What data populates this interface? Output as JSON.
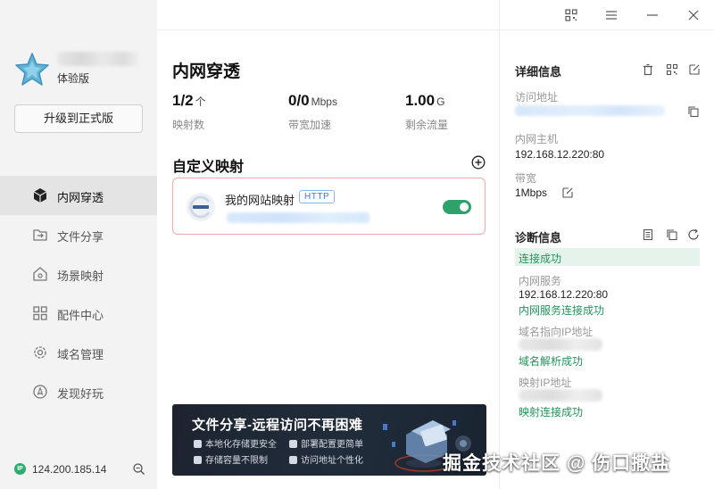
{
  "sidebar": {
    "edition": "体验版",
    "upgrade_label": "升级到正式版",
    "items": [
      {
        "label": "内网穿透",
        "icon": "cube-icon",
        "active": true
      },
      {
        "label": "文件分享",
        "icon": "folder-share-icon",
        "active": false
      },
      {
        "label": "场景映射",
        "icon": "house-icon",
        "active": false
      },
      {
        "label": "配件中心",
        "icon": "grid-icon",
        "active": false
      },
      {
        "label": "域名管理",
        "icon": "gear-icon",
        "active": false
      },
      {
        "label": "发现好玩",
        "icon": "compass-icon",
        "active": false
      }
    ],
    "ip": "124.200.185.14",
    "ip_badge": "IP"
  },
  "main": {
    "title": "内网穿透",
    "stats": [
      {
        "value": "1/2",
        "unit": "个",
        "label": "映射数"
      },
      {
        "value": "0/0",
        "unit": "Mbps",
        "label": "带宽加速"
      },
      {
        "value": "1.00",
        "unit": "G",
        "label": "剩余流量"
      }
    ],
    "custom_mapping_title": "自定义映射",
    "mapping": {
      "name": "我的网站映射",
      "protocol": "HTTP",
      "enabled": true
    },
    "banner": {
      "title": "文件分享-远程访问不再困难",
      "features": [
        "本地化存储更安全",
        "部署配置更简单",
        "存储容量不限制",
        "访问地址个性化"
      ]
    }
  },
  "details": {
    "title": "详细信息",
    "access_label": "访问地址",
    "host_label": "内网主机",
    "host_value": "192.168.12.220:80",
    "bandwidth_label": "带宽",
    "bandwidth_value": "1Mbps"
  },
  "diagnostics": {
    "title": "诊断信息",
    "status": "连接成功",
    "service_label": "内网服务",
    "service_value": "192.168.12.220:80",
    "service_status": "内网服务连接成功",
    "dns_label": "域名指向IP地址",
    "dns_status": "域名解析成功",
    "map_ip_label": "映射IP地址",
    "map_status": "映射连接成功"
  },
  "watermark": "掘金技术社区 @ 伤口撒盐",
  "colors": {
    "accent_green": "#2ea26a",
    "success_text": "#23935b",
    "card_border": "#f1a9b0",
    "tag_blue": "#3b78d8"
  }
}
